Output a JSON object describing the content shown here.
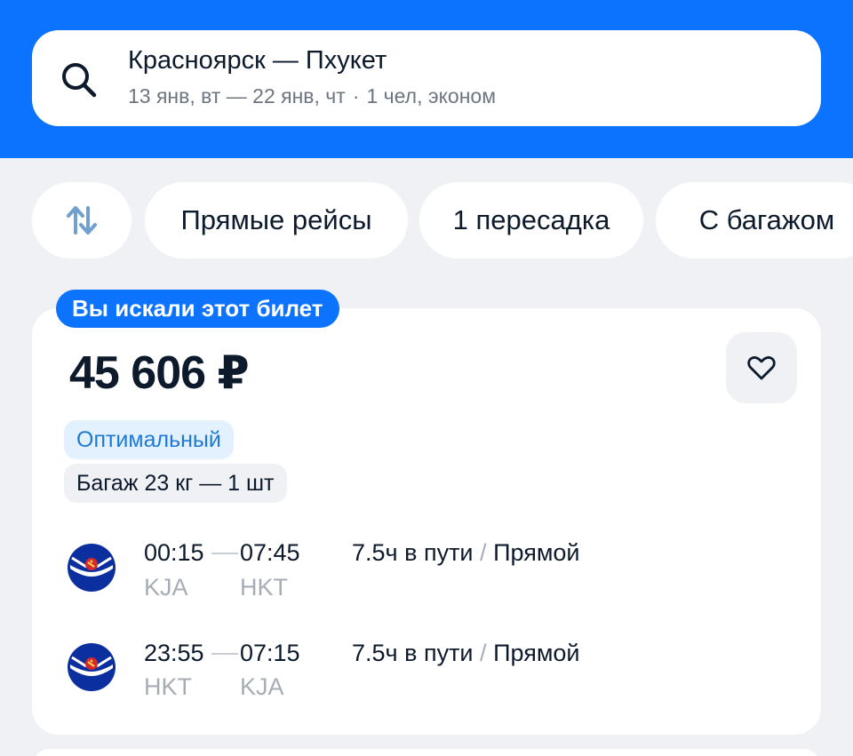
{
  "search": {
    "route": "Красноярск — Пхукет",
    "dates": "13 янв, вт — 22 янв, чт",
    "dot": "·",
    "passengers": "1 чел, эконом"
  },
  "filters": {
    "sort_icon": "sort-arrows-icon",
    "direct": "Прямые рейсы",
    "one_transfer": "1 пересадка",
    "baggage": "С багажом"
  },
  "ticket": {
    "badge": "Вы искали этот билет",
    "price": "45 606 ₽",
    "tag_optimal": "Оптимальный",
    "tag_baggage": "Багаж 23 кг — 1 шт",
    "favorite_icon": "heart-icon",
    "segments": [
      {
        "depart_time": "00:15",
        "arrive_time": "07:45",
        "depart_code": "KJA",
        "arrive_code": "HKT",
        "duration": "7.5ч в пути",
        "slash": "/",
        "type": "Прямой"
      },
      {
        "depart_time": "23:55",
        "arrive_time": "07:15",
        "depart_code": "HKT",
        "arrive_code": "KJA",
        "duration": "7.5ч в пути",
        "slash": "/",
        "type": "Прямой"
      }
    ]
  },
  "colors": {
    "brand_blue": "#0c73fe",
    "background": "#eff1f4",
    "optimal_text": "#1d7bd6",
    "airline_blue": "#0b2f9f"
  }
}
